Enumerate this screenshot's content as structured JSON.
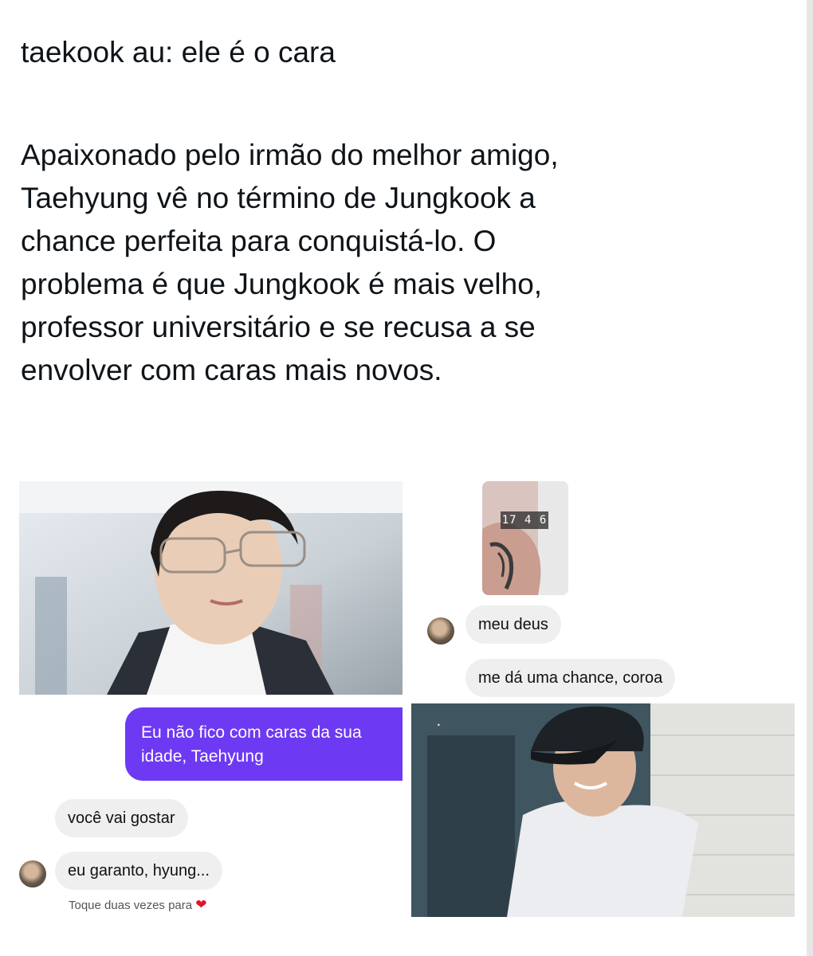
{
  "post": {
    "title": "taekook au: ele é o cara",
    "body": "Apaixonado pelo irmão do melhor amigo,\nTaehyung vê no término de Jungkook a\nchance perfeita para conquistá-lo. O\nproblema é que Jungkook é mais velho,\nprofessor universitário e se recusa a se\nenvolver com caras mais novos."
  },
  "chat_right": {
    "timestamp": "17 4 6",
    "messages": [
      "meu deus",
      "me dá uma chance, coroa"
    ]
  },
  "chat_left": {
    "sent_message": "Eu não fico com caras da sua\nidade, Taehyung",
    "messages": [
      "você vai gostar",
      "eu garanto, hyung..."
    ],
    "hint": "Toque duas vezes para",
    "hint_icon": "heart-icon"
  },
  "colors": {
    "sent_bubble": "#6e39f3",
    "received_bubble": "#efefef",
    "heart": "#e0142b"
  }
}
